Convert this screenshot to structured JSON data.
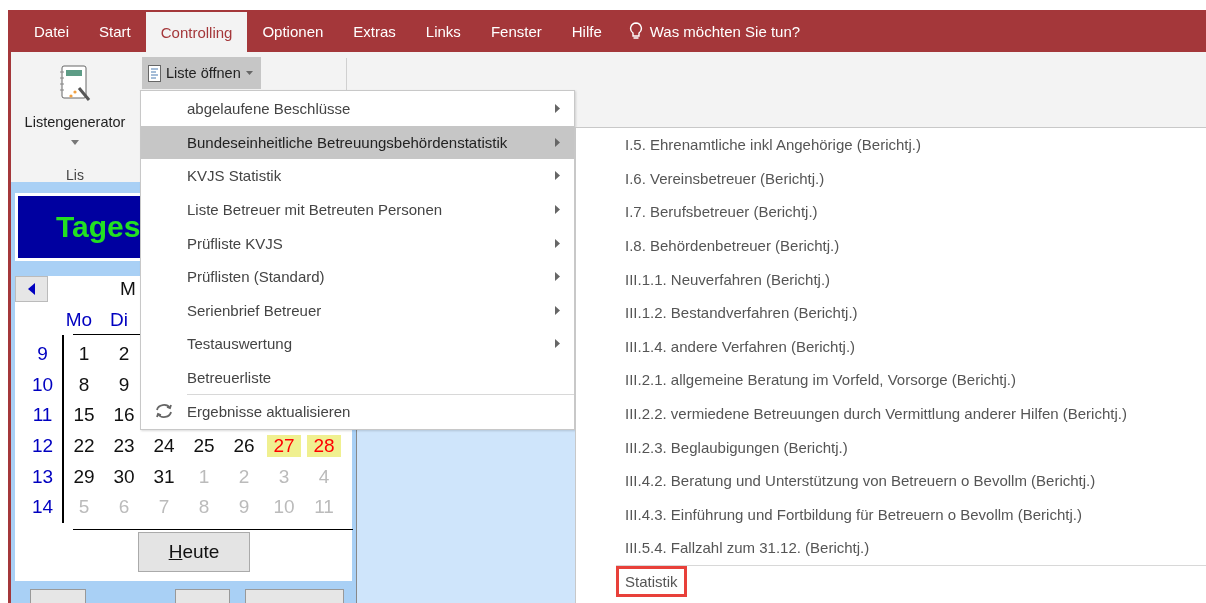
{
  "menu_bar": {
    "tabs": [
      {
        "label": "Datei",
        "selected": false
      },
      {
        "label": "Start",
        "selected": false
      },
      {
        "label": "Controlling",
        "selected": true
      },
      {
        "label": "Optionen",
        "selected": false
      },
      {
        "label": "Extras",
        "selected": false
      },
      {
        "label": "Links",
        "selected": false
      },
      {
        "label": "Fenster",
        "selected": false
      },
      {
        "label": "Hilfe",
        "selected": false
      }
    ],
    "search": {
      "placeholder": "Was möchten Sie tun?"
    }
  },
  "ribbon": {
    "large_button": {
      "label": "Listengenerator"
    },
    "dropdown_button": {
      "label": "Liste öffnen",
      "expanded": true
    },
    "group_label": "Lis"
  },
  "menu": {
    "items": [
      {
        "label": "abgelaufene Beschlüsse",
        "kind": "submenu",
        "selected": false,
        "separator_before": false
      },
      {
        "label": "Bundeseinheitliche Betreuungsbehördenstatistik",
        "kind": "submenu",
        "selected": true,
        "separator_before": false
      },
      {
        "label": "KVJS Statistik",
        "kind": "submenu",
        "selected": false,
        "separator_before": false
      },
      {
        "label": "Liste Betreuer mit Betreuten Personen",
        "kind": "submenu",
        "selected": false,
        "separator_before": false
      },
      {
        "label": "Prüfliste KVJS",
        "kind": "submenu",
        "selected": false,
        "separator_before": false
      },
      {
        "label": "Prüflisten (Standard)",
        "kind": "submenu",
        "selected": false,
        "separator_before": false
      },
      {
        "label": "Serienbrief Betreuer",
        "kind": "submenu",
        "selected": false,
        "separator_before": false
      },
      {
        "label": "Testauswertung",
        "kind": "submenu",
        "selected": false,
        "separator_before": false
      },
      {
        "label": "Betreuerliste",
        "kind": "plain",
        "selected": false,
        "separator_before": false
      },
      {
        "label": "Ergebnisse aktualisieren",
        "kind": "refresh",
        "selected": false,
        "separator_before": true
      }
    ]
  },
  "submenu": {
    "items": [
      {
        "label": "I.5. Ehrenamtliche inkl Angehörige (Berichtj.)",
        "highlighted": false,
        "separator_before": false
      },
      {
        "label": "I.6. Vereinsbetreuer (Berichtj.)",
        "highlighted": false,
        "separator_before": false
      },
      {
        "label": "I.7. Berufsbetreuer (Berichtj.)",
        "highlighted": false,
        "separator_before": false
      },
      {
        "label": "I.8. Behördenbetreuer (Berichtj.)",
        "highlighted": false,
        "separator_before": false
      },
      {
        "label": "III.1.1. Neuverfahren (Berichtj.)",
        "highlighted": false,
        "separator_before": false
      },
      {
        "label": "III.1.2. Bestandverfahren (Berichtj.)",
        "highlighted": false,
        "separator_before": false
      },
      {
        "label": "III.1.4. andere Verfahren (Berichtj.)",
        "highlighted": false,
        "separator_before": false
      },
      {
        "label": "III.2.1. allgemeine Beratung im Vorfeld, Vorsorge (Berichtj.)",
        "highlighted": false,
        "separator_before": false
      },
      {
        "label": "III.2.2. vermiedene Betreuungen durch Vermittlung anderer Hilfen (Berichtj.)",
        "highlighted": false,
        "separator_before": false
      },
      {
        "label": "III.2.3. Beglaubigungen (Berichtj.)",
        "highlighted": false,
        "separator_before": false
      },
      {
        "label": "III.4.2. Beratung und Unterstützung von Betreuern o Bevollm (Berichtj.)",
        "highlighted": false,
        "separator_before": false
      },
      {
        "label": "III.4.3. Einführung und Fortbildung für Betreuern o Bevollm (Berichtj.)",
        "highlighted": false,
        "separator_before": false
      },
      {
        "label": "III.5.4. Fallzahl zum 31.12. (Berichtj.)",
        "highlighted": false,
        "separator_before": false
      },
      {
        "label": "Statistik",
        "highlighted": true,
        "separator_before": true
      }
    ]
  },
  "left_panel": {
    "title": "Tages",
    "calendar": {
      "month": "M",
      "weekdays": [
        "Mo",
        "Di"
      ],
      "today_button": "Heute",
      "weeks": [
        {
          "week": "9",
          "days": [
            {
              "text": "1",
              "kind": "current"
            },
            {
              "text": "2",
              "kind": "current"
            }
          ]
        },
        {
          "week": "10",
          "days": [
            {
              "text": "8",
              "kind": "current"
            },
            {
              "text": "9",
              "kind": "current"
            }
          ]
        },
        {
          "week": "11",
          "days": [
            {
              "text": "15",
              "kind": "current"
            },
            {
              "text": "16",
              "kind": "current"
            }
          ]
        },
        {
          "week": "12",
          "days": [
            {
              "text": "22",
              "kind": "current"
            },
            {
              "text": "23",
              "kind": "current"
            },
            {
              "text": "24",
              "kind": "current"
            },
            {
              "text": "25",
              "kind": "current"
            },
            {
              "text": "26",
              "kind": "current"
            },
            {
              "text": "27",
              "kind": "marked"
            },
            {
              "text": "28",
              "kind": "marked"
            }
          ]
        },
        {
          "week": "13",
          "days": [
            {
              "text": "29",
              "kind": "current"
            },
            {
              "text": "30",
              "kind": "current"
            },
            {
              "text": "31",
              "kind": "current"
            },
            {
              "text": "1",
              "kind": "other"
            },
            {
              "text": "2",
              "kind": "other"
            },
            {
              "text": "3",
              "kind": "other"
            },
            {
              "text": "4",
              "kind": "other"
            }
          ]
        },
        {
          "week": "14",
          "days": [
            {
              "text": "5",
              "kind": "other"
            },
            {
              "text": "6",
              "kind": "other"
            },
            {
              "text": "7",
              "kind": "other"
            },
            {
              "text": "8",
              "kind": "other"
            },
            {
              "text": "9",
              "kind": "other"
            },
            {
              "text": "10",
              "kind": "other"
            },
            {
              "text": "11",
              "kind": "other"
            }
          ]
        }
      ]
    }
  }
}
